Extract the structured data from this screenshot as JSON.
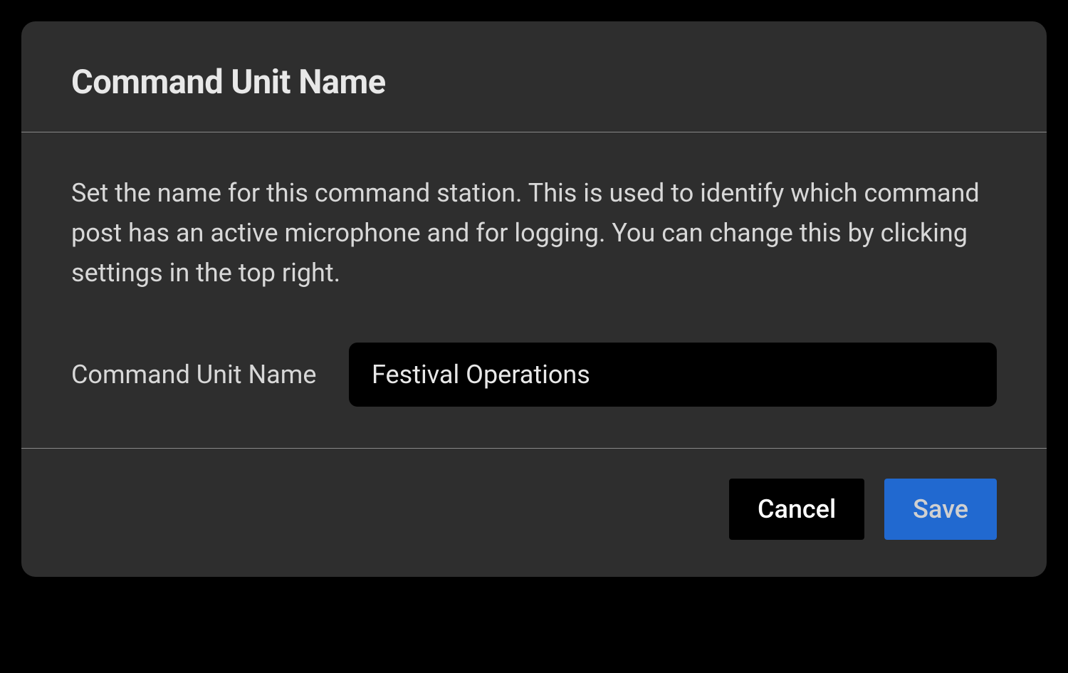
{
  "modal": {
    "title": "Command Unit Name",
    "description": "Set the name for this command station. This is used to identify which command post has an active microphone and for logging. You can change this by clicking settings in the top right.",
    "form": {
      "label": "Command Unit Name",
      "value": "Festival Operations"
    },
    "buttons": {
      "cancel": "Cancel",
      "save": "Save"
    }
  },
  "colors": {
    "modalBg": "#2e2e2e",
    "pageBg": "#000000",
    "accent": "#2169d0",
    "text": "#d8d8d8"
  }
}
